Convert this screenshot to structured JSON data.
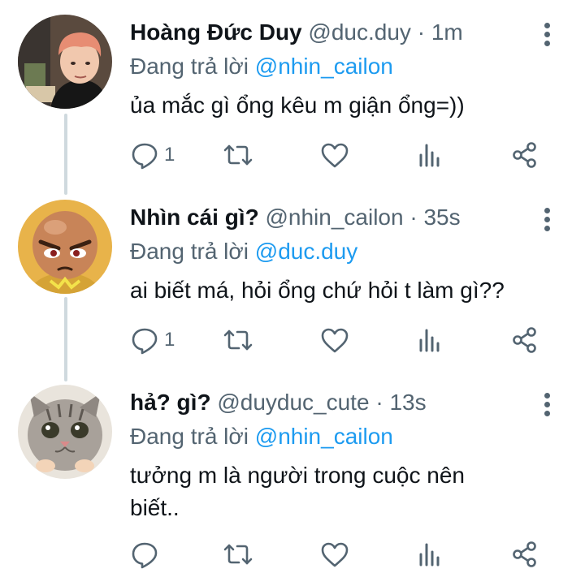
{
  "tweets": [
    {
      "name": "Hoàng Đức Duy",
      "handle": "@duc.duy",
      "separator": "·",
      "time": "1m",
      "reply_prefix": "Đang trả lời",
      "reply_to": "@nhin_cailon",
      "text": "ủa mắc gì ổng kêu m giận ổng=))",
      "reply_count": "1"
    },
    {
      "name": "Nhìn cái gì?",
      "handle": "@nhin_cailon",
      "separator": "·",
      "time": "35s",
      "reply_prefix": "Đang trả lời",
      "reply_to": "@duc.duy",
      "text": "ai biết má, hỏi ổng chứ hỏi t làm gì??",
      "reply_count": "1"
    },
    {
      "name": "hả? gì?",
      "handle": "@duyduc_cute",
      "separator": "·",
      "time": "13s",
      "reply_prefix": "Đang trả lời",
      "reply_to": "@nhin_cailon",
      "text": "tưởng m là người trong cuộc nên biết..",
      "reply_count": ""
    }
  ],
  "icons": {
    "reply": "reply-icon",
    "retweet": "retweet-icon",
    "like": "heart-icon",
    "views": "views-icon",
    "share": "share-icon",
    "more": "more-vertical-icon"
  },
  "colors": {
    "text": "#0f1419",
    "muted": "#536471",
    "link": "#1d9bf0",
    "thread_line": "#cfd9de"
  }
}
